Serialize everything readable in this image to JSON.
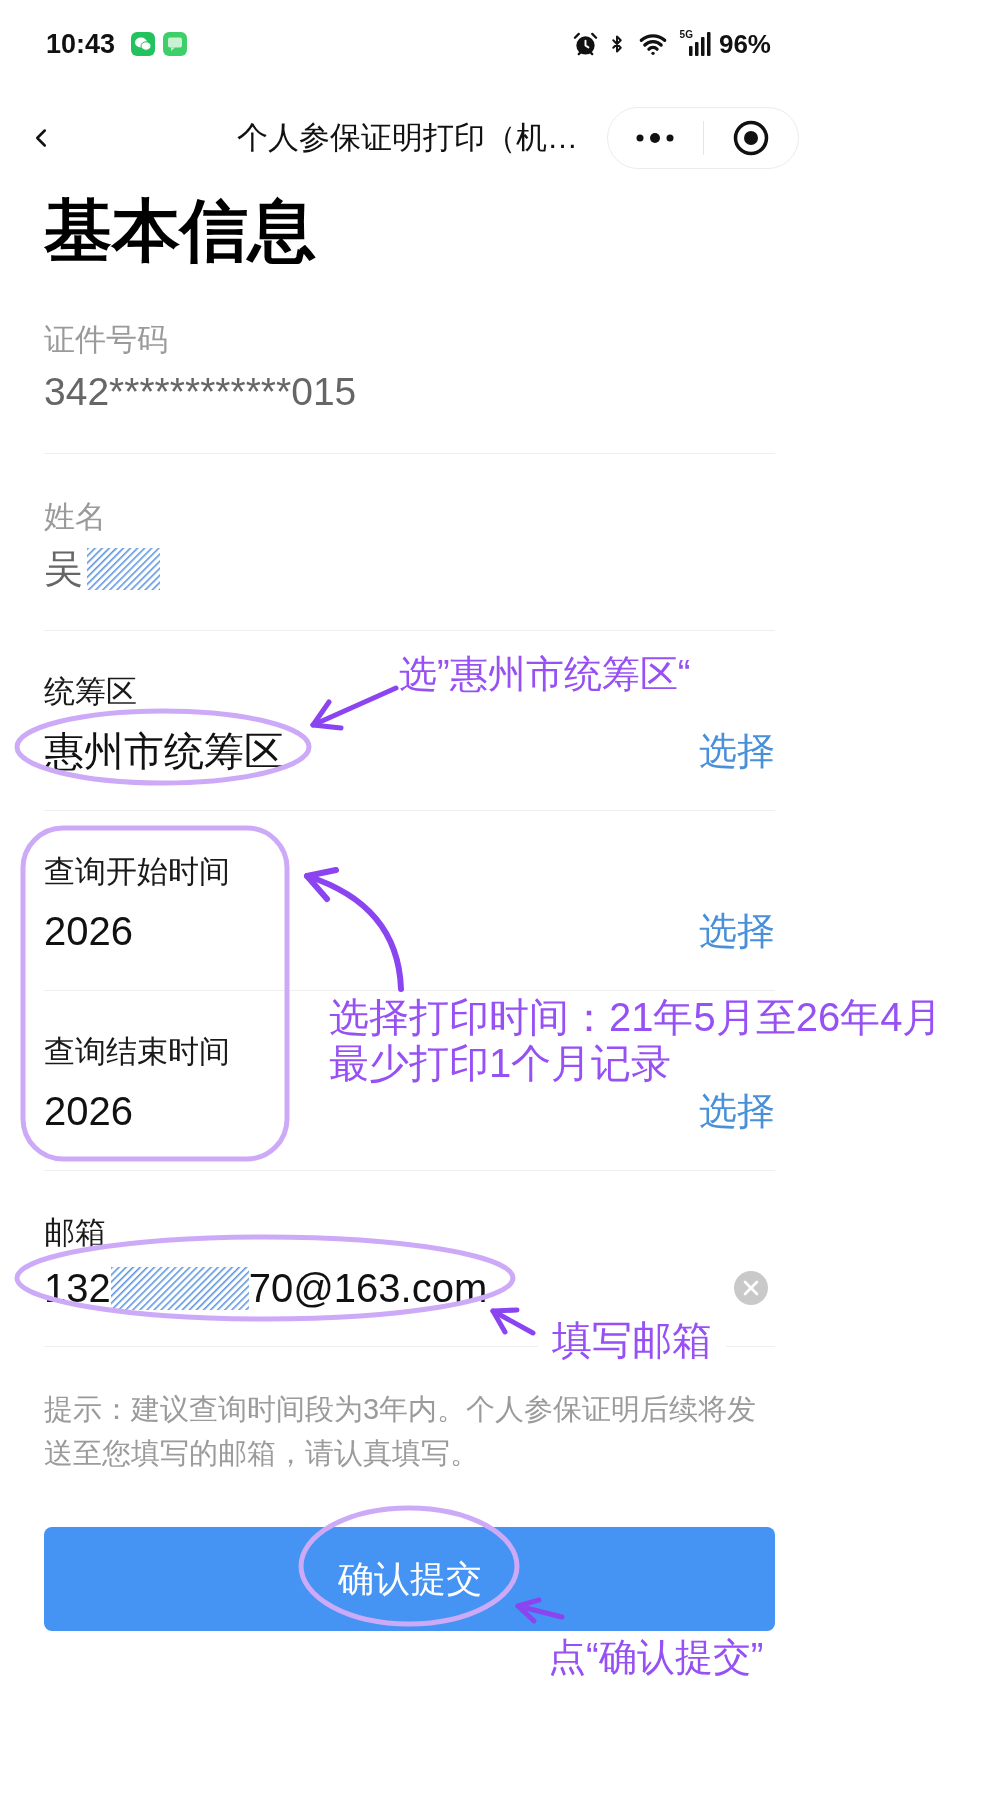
{
  "status_bar": {
    "time": "10:43",
    "network": "5G",
    "battery": "96%"
  },
  "nav_bar": {
    "title": "个人参保证明打印（机…"
  },
  "heading": "基本信息",
  "fields": [
    {
      "kind": "readonly",
      "label": "证件号码",
      "value": "342************015"
    },
    {
      "kind": "readonly",
      "label": "姓名",
      "value": "吴",
      "redacted": true
    },
    {
      "kind": "select",
      "label": "统筹区",
      "value": "惠州市统筹区",
      "action": "选择"
    },
    {
      "kind": "select",
      "label": "查询开始时间",
      "value": "2026",
      "action": "选择"
    },
    {
      "kind": "select",
      "label": "查询结束时间",
      "value": "2026",
      "action": "选择"
    },
    {
      "kind": "input",
      "label": "邮箱",
      "value": "132",
      "value_end": "70@163.com",
      "redacted": true
    }
  ],
  "hint": "提示：建议查询时间段为3年内。个人参保证明后续将发送至您填写的邮箱，请认真填写。",
  "submit_button": "确认提交",
  "annotations": [
    {
      "text": "选”惠州市统筹区“"
    },
    {
      "lines": [
        "选择打印时间：21年5月至26年4月",
        "最少打印1个月记录"
      ]
    },
    {
      "text": "填写邮箱"
    },
    {
      "text": "点“确认提交”"
    }
  ]
}
